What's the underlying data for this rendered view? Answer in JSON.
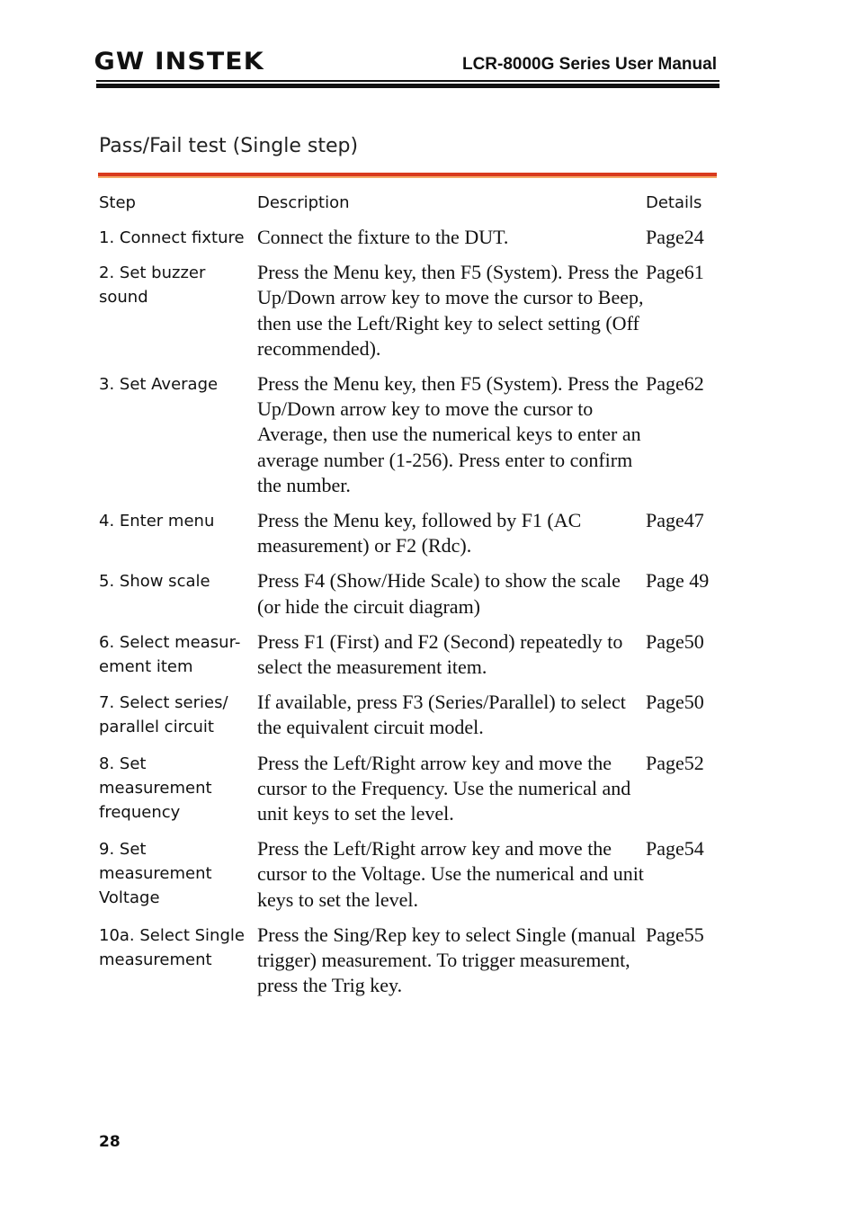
{
  "header": {
    "brand_logo": "GW INSTEK",
    "manual_title": "LCR-8000G Series User Manual"
  },
  "section": {
    "title": "Pass/Fail test (Single step)",
    "accent_color": "#d93a1e",
    "accent_light_color": "#f4a866"
  },
  "table": {
    "columns": [
      "Step",
      "Description",
      "Details"
    ],
    "rows": [
      {
        "step": "1. Connect fixture",
        "description": "Connect the fixture to the DUT.",
        "details": "Page24"
      },
      {
        "step": "2. Set buzzer sound",
        "description": "Press the Menu key, then F5 (System). Press the Up/Down arrow key to move the cursor to Beep, then use the Left/Right key to select setting (Off recommended).",
        "details": "Page61"
      },
      {
        "step": "3. Set Average",
        "description": "Press the Menu key, then F5 (System). Press the Up/Down arrow key to move the cursor to Average, then use the numerical keys to enter an average number (1-256). Press enter to confirm the number.",
        "details": "Page62"
      },
      {
        "step": "4. Enter menu",
        "description": "Press the Menu key, followed by F1 (AC measurement) or F2 (Rdc).",
        "details": "Page47"
      },
      {
        "step": "5. Show scale",
        "description": "Press F4 (Show/Hide Scale) to show the scale (or hide the circuit diagram)",
        "details": "Page 49"
      },
      {
        "step": "6. Select measur-ement item",
        "description": "Press F1 (First) and F2 (Second) repeatedly to select the measurement item.",
        "details": "Page50"
      },
      {
        "step": "7. Select series/ parallel circuit",
        "description": "If available, press F3 (Series/Parallel) to select the equivalent circuit model.",
        "details": "Page50"
      },
      {
        "step": "8. Set measurement frequency",
        "description": "Press the Left/Right arrow key and move the cursor to the Frequency. Use the numerical and unit keys to set the level.",
        "details": "Page52"
      },
      {
        "step": "9. Set measurement Voltage",
        "description": "Press the Left/Right arrow key and move the cursor to the Voltage. Use the numerical and unit keys to set the level.",
        "details": "Page54"
      },
      {
        "step": "10a. Select Single measurement",
        "description": "Press the Sing/Rep key to select Single (manual trigger) measurement. To trigger measurement, press the Trig key.",
        "details": "Page55"
      }
    ]
  },
  "footer": {
    "page_number": "28"
  }
}
